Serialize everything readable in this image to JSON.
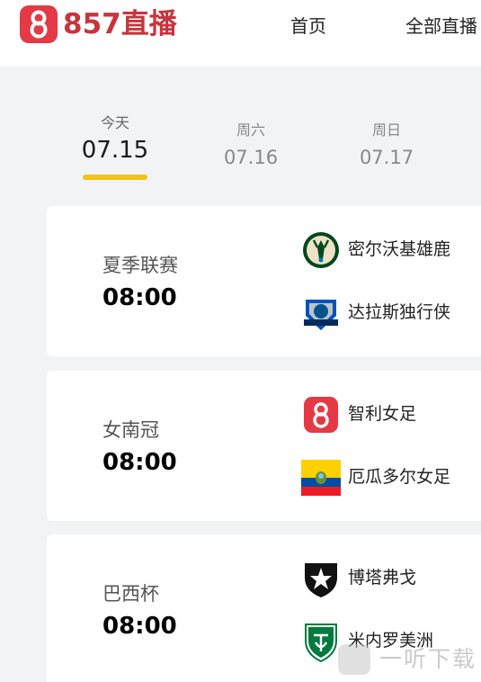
{
  "header": {
    "logo_text": "857直播",
    "nav": [
      {
        "label": "首页"
      },
      {
        "label": "全部直播"
      }
    ]
  },
  "date_tabs": [
    {
      "weekday": "今天",
      "date": "07.15",
      "active": true
    },
    {
      "weekday": "周六",
      "date": "07.16",
      "active": false
    },
    {
      "weekday": "周日",
      "date": "07.17",
      "active": false
    }
  ],
  "matches": [
    {
      "league": "夏季联赛",
      "time": "08:00",
      "home": {
        "name": "密尔沃基雄鹿",
        "logo": "bucks-logo-icon"
      },
      "away": {
        "name": "达拉斯独行侠",
        "logo": "mavericks-logo-icon"
      }
    },
    {
      "league": "女南冠",
      "time": "08:00",
      "home": {
        "name": "智利女足",
        "logo": "default-team-logo-icon"
      },
      "away": {
        "name": "厄瓜多尔女足",
        "logo": "ecuador-flag-icon"
      }
    },
    {
      "league": "巴西杯",
      "time": "08:00",
      "home": {
        "name": "博塔弗戈",
        "logo": "botafogo-logo-icon"
      },
      "away": {
        "name": "米内罗美洲",
        "logo": "america-mineiro-logo-icon"
      }
    }
  ],
  "colors": {
    "brand": "#c8343d",
    "accent": "#f3c31a",
    "background": "#f2f3f5"
  },
  "watermark": {
    "text": "一听下载"
  }
}
